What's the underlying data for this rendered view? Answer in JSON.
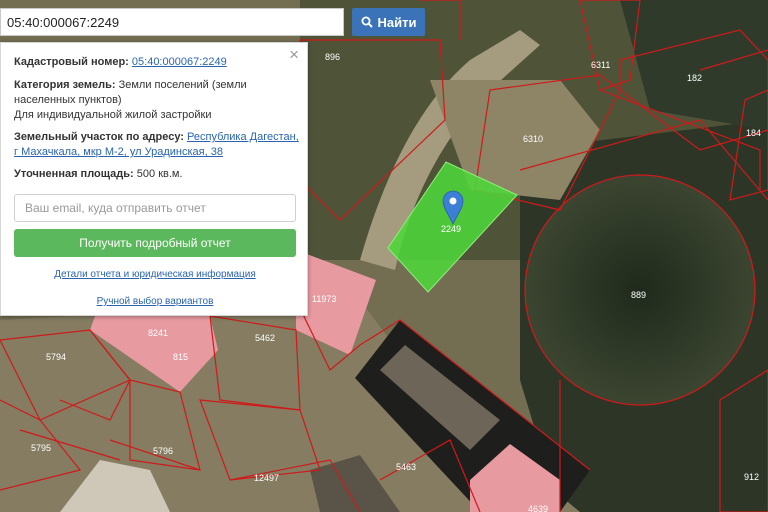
{
  "search": {
    "value": "05:40:000067:2249",
    "button_label": "Найти"
  },
  "info": {
    "cadastral_label": "Кадастровый номер:",
    "cadastral_value": "05:40:000067:2249",
    "category_label": "Категория земель:",
    "category_value": "Земли поселений (земли населенных пунктов)",
    "usage_value": "Для индивидуальной жилой застройки",
    "address_label": "Земельный участок по адресу:",
    "address_value": "Республика Дагестан, г Махачкала, мкр М-2, ул Урадинская, 38",
    "area_label": "Уточненная площадь:",
    "area_value": "500 кв.м.",
    "email_placeholder": "Ваш email, куда отправить отчет",
    "report_button": "Получить подробный отчет",
    "details_link": "Детали отчета и юридическая информация",
    "manual_link": "Ручной выбор вариантов",
    "close_symbol": "×"
  },
  "map": {
    "marker_label": "2249",
    "parcel_labels": [
      "896",
      "6311",
      "182",
      "184",
      "6310",
      "889",
      "11973",
      "5462",
      "8241",
      "815",
      "5794",
      "5795",
      "5796",
      "12497",
      "5463",
      "912",
      "4639"
    ]
  },
  "colors": {
    "accent": "#3a73b8",
    "success": "#5cb85c",
    "parcel_border": "#d01a1a",
    "building": "#e79aa0",
    "selected": "#4ed63a",
    "marker": "#3b7fd6"
  },
  "icons": {
    "search": "search-icon",
    "close": "close-icon",
    "marker": "map-marker-icon"
  }
}
